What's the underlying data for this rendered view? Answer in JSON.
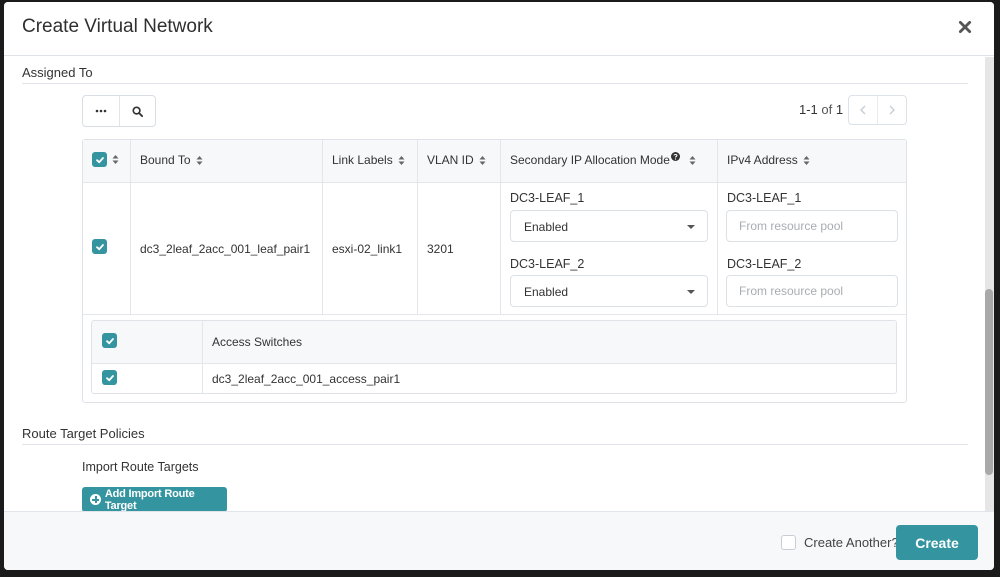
{
  "modal": {
    "title": "Create Virtual Network",
    "close_icon": "close-icon"
  },
  "assigned_to": {
    "section_title": "Assigned To",
    "toolbar": {
      "more_icon": "ellipsis-icon",
      "search_icon": "search-icon"
    },
    "pagination": {
      "range": "1-1",
      "of_label": "of",
      "total": "1",
      "prev_icon": "chevron-left-icon",
      "next_icon": "chevron-right-icon"
    },
    "table": {
      "header_select_all_checked": true,
      "columns": [
        "Bound To",
        "Link Labels",
        "VLAN ID",
        "Secondary IP Allocation Mode",
        "IPv4 Address"
      ],
      "help_icon": "question-circle-icon",
      "rows": [
        {
          "checked": true,
          "bound_to": "dc3_2leaf_2acc_001_leaf_pair1",
          "link_labels": "esxi-02_link1",
          "vlan_id": "3201",
          "secondary_ip": [
            {
              "device": "DC3-LEAF_1",
              "value": "Enabled"
            },
            {
              "device": "DC3-LEAF_2",
              "value": "Enabled"
            }
          ],
          "ipv4": [
            {
              "device": "DC3-LEAF_1",
              "value": "",
              "placeholder": "From resource pool"
            },
            {
              "device": "DC3-LEAF_2",
              "value": "",
              "placeholder": "From resource pool"
            }
          ],
          "access_switches": {
            "header": "Access Switches",
            "header_checked": true,
            "rows": [
              {
                "checked": true,
                "name": "dc3_2leaf_2acc_001_access_pair1"
              }
            ]
          }
        }
      ]
    }
  },
  "route_target_policies": {
    "section_title": "Route Target Policies",
    "import_label": "Import Route Targets",
    "add_import_button": "Add Import Route Target"
  },
  "footer": {
    "create_another_label": "Create Another?",
    "create_another_checked": false,
    "create_button": "Create"
  },
  "colors": {
    "accent": "#3495a0",
    "backdrop": "#1b1b1b"
  }
}
